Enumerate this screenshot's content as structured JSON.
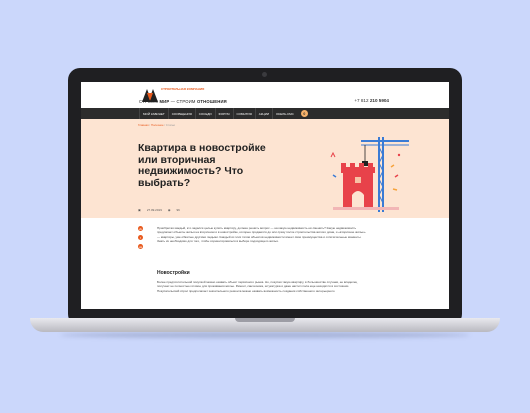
{
  "header": {
    "logo_sup": "СТРОИТЕЛЬНАЯ КОМПАНИЯ",
    "slogan_1": "СТРОИМ ",
    "slogan_2": "МИР",
    "slogan_3": " — СТРОИМ ",
    "slogan_4": "ОТНОШЕНИЯ",
    "phone_prefix": "+7 812 ",
    "phone_main": "210 5904"
  },
  "nav": {
    "items": [
      "МОЙ КАБИНЕТ",
      "СООБЩЕНИЯ",
      "СОСЕДИ",
      "ФОРУМ",
      "СОБЫТИЯ",
      "АКЦИИ",
      "ОКЕЛЬ-СМС"
    ],
    "cart_count": "0"
  },
  "hero": {
    "crumbs": [
      "Главная",
      "Полезное",
      "Статьи"
    ],
    "title": "Квартира в новостройке или вторичная недвижимость? Что выбрать?",
    "date": "27.09.2019",
    "views": "96"
  },
  "social": [
    "vk",
    "f",
    "ok"
  ],
  "content": {
    "intro": "Приобретая каждый, кто задался целью купить квартиру, должен решить вопрос — на какую недвижимость её сменить? Какую недвижимость предлагает объекты жилья на вторичном и в новостройке, которые продаются до или сразу после строительства жилого дома, и «вторичное жилье» — квартиры, уже обжитые другими людьми. Каждый из этих типов объектов недвижимости имеет свои преимущества и отличительные моменты. Знать их необходимо для того, чтобы сориентироваться в выборе подходящего жилья.",
    "section_title": "Новостройки",
    "section_body": "Более предпочтительной покупкой можно назвать объект первичного рынка. Но, покупая такую квартиру, в большинстве случаев, ее владелец получает не полностью готовое для проживания жилье. Ремонт, сантехника, штукатурка и даже настил пола еще находятся в состоянии. Покупательский спрос предполагает значительного ремонта можно назвать возможность создания собственного интерьерного"
  },
  "colors": {
    "accent": "#e85a1e",
    "hero_bg": "#fde4d2",
    "nav_bg": "#2c2c2c",
    "page_bg": "#cbd7fb"
  }
}
